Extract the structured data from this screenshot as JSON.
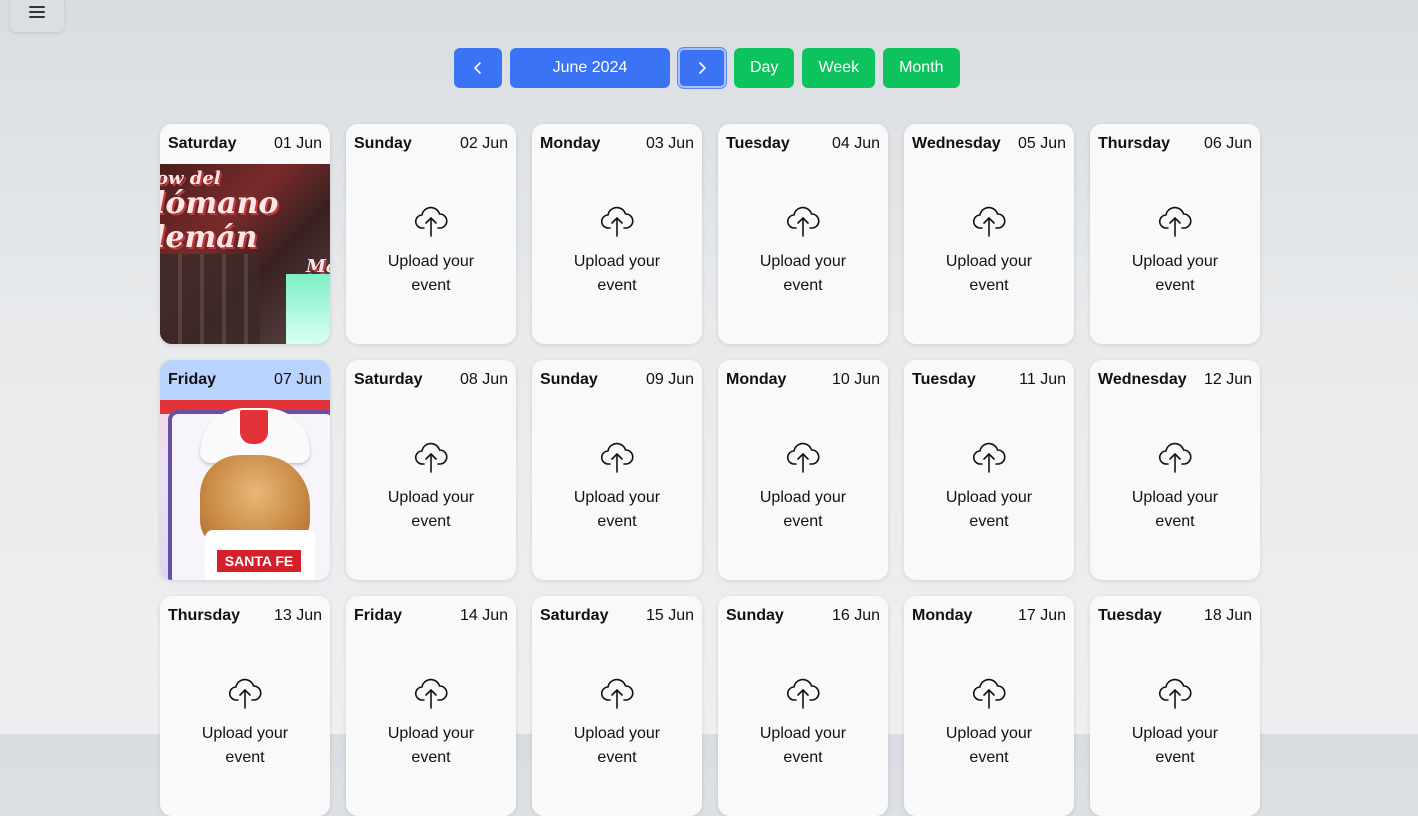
{
  "header": {
    "menu_icon": "hamburger-menu-icon",
    "prev_icon": "chevron-left-icon",
    "next_icon": "chevron-right-icon",
    "month_label": "June 2024",
    "views": [
      "Day",
      "Week",
      "Month"
    ]
  },
  "colors": {
    "primary": "#3a73f4",
    "success": "#0dc35d",
    "today_header": "#b8d4ff"
  },
  "upload_text": "Upload your event",
  "days": [
    {
      "name": "Saturday",
      "date": "01 Jun",
      "has_image": true,
      "image": "flyer"
    },
    {
      "name": "Sunday",
      "date": "02 Jun",
      "has_image": false
    },
    {
      "name": "Monday",
      "date": "03 Jun",
      "has_image": false
    },
    {
      "name": "Tuesday",
      "date": "04 Jun",
      "has_image": false
    },
    {
      "name": "Wednesday",
      "date": "05 Jun",
      "has_image": false
    },
    {
      "name": "Thursday",
      "date": "06 Jun",
      "has_image": false
    },
    {
      "name": "Friday",
      "date": "07 Jun",
      "has_image": true,
      "image": "shirt",
      "today": true
    },
    {
      "name": "Saturday",
      "date": "08 Jun",
      "has_image": false
    },
    {
      "name": "Sunday",
      "date": "09 Jun",
      "has_image": false
    },
    {
      "name": "Monday",
      "date": "10 Jun",
      "has_image": false
    },
    {
      "name": "Tuesday",
      "date": "11 Jun",
      "has_image": false
    },
    {
      "name": "Wednesday",
      "date": "12 Jun",
      "has_image": false
    },
    {
      "name": "Thursday",
      "date": "13 Jun",
      "has_image": false
    },
    {
      "name": "Friday",
      "date": "14 Jun",
      "has_image": false
    },
    {
      "name": "Saturday",
      "date": "15 Jun",
      "has_image": false
    },
    {
      "name": "Sunday",
      "date": "16 Jun",
      "has_image": false
    },
    {
      "name": "Monday",
      "date": "17 Jun",
      "has_image": false
    },
    {
      "name": "Tuesday",
      "date": "18 Jun",
      "has_image": false
    }
  ],
  "flyer_text": [
    "ow del",
    "lómano",
    "lemán",
    "Ma"
  ],
  "shirt_text": "SANTA FE"
}
